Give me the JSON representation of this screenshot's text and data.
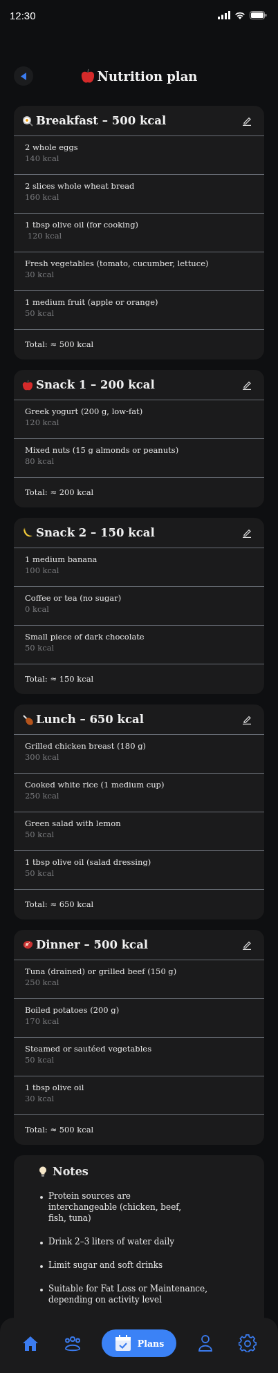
{
  "status_bar": {
    "time": "12:30"
  },
  "header": {
    "title": "Nutrition plan"
  },
  "meals": [
    {
      "kind": "egg",
      "title": "Breakfast – 500 kcal",
      "items": [
        {
          "name": "2 whole eggs",
          "kcal": "140 kcal"
        },
        {
          "name": "2 slices whole wheat bread",
          "kcal": "160 kcal"
        },
        {
          "name": "1 tbsp olive oil (for cooking)",
          "kcal": " 120 kcal"
        },
        {
          "name": "Fresh vegetables (tomato, cucumber, lettuce)",
          "kcal": "30 kcal"
        },
        {
          "name": "1 medium fruit (apple or orange)",
          "kcal": "50 kcal"
        }
      ],
      "total": "Total: ≈ 500 kcal"
    },
    {
      "kind": "apple",
      "title": "Snack 1 – 200 kcal",
      "items": [
        {
          "name": "Greek yogurt (200 g, low-fat)",
          "kcal": "120 kcal"
        },
        {
          "name": "Mixed nuts (15 g almonds or peanuts)",
          "kcal": "80 kcal"
        }
      ],
      "total": "Total: ≈ 200 kcal"
    },
    {
      "kind": "banana",
      "title": "Snack 2 – 150 kcal",
      "items": [
        {
          "name": "1 medium banana",
          "kcal": "100 kcal"
        },
        {
          "name": "Coffee or tea (no sugar)",
          "kcal": "0 kcal"
        },
        {
          "name": "Small piece of dark chocolate",
          "kcal": "50 kcal"
        }
      ],
      "total": "Total: ≈ 150 kcal"
    },
    {
      "kind": "drumstick",
      "title": "Lunch – 650 kcal",
      "items": [
        {
          "name": "Grilled chicken breast (180 g)",
          "kcal": "300 kcal"
        },
        {
          "name": "Cooked white rice (1 medium cup)",
          "kcal": "250 kcal"
        },
        {
          "name": "Green salad with lemon",
          "kcal": "50 kcal"
        },
        {
          "name": "1 tbsp olive oil (salad dressing)",
          "kcal": "50 kcal"
        }
      ],
      "total": "Total: ≈ 650 kcal"
    },
    {
      "kind": "meat",
      "title": "Dinner – 500 kcal",
      "items": [
        {
          "name": "Tuna (drained) or grilled beef (150 g)",
          "kcal": "250 kcal"
        },
        {
          "name": "Boiled potatoes (200 g)",
          "kcal": "170 kcal"
        },
        {
          "name": "Steamed or sautéed vegetables",
          "kcal": "50 kcal"
        },
        {
          "name": "1 tbsp olive oil",
          "kcal": "30 kcal"
        }
      ],
      "total": "Total: ≈ 500 kcal"
    }
  ],
  "notes": {
    "title": "Notes",
    "items": [
      "Protein sources are interchangeable (chicken, beef, fish, tuna)",
      "Drink 2–3 liters of water daily",
      "Limit sugar and soft drinks",
      "Suitable for Fat Loss or Maintenance, depending on activity level"
    ]
  },
  "nav": [
    {
      "kind": "home",
      "selected": false
    },
    {
      "kind": "people",
      "selected": false
    },
    {
      "kind": "plans",
      "label": "Plans",
      "selected": true
    },
    {
      "kind": "profile",
      "selected": false
    },
    {
      "kind": "settings",
      "selected": false
    }
  ]
}
